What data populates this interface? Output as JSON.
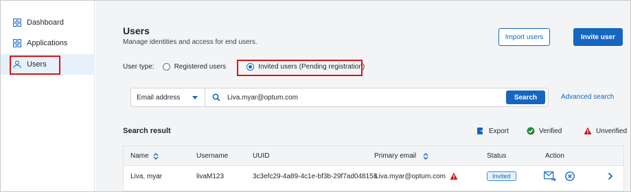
{
  "sidebar": {
    "items": [
      {
        "label": "Dashboard",
        "icon": "dashboard-icon"
      },
      {
        "label": "Applications",
        "icon": "applications-icon"
      },
      {
        "label": "Users",
        "icon": "user-icon",
        "active": true
      }
    ]
  },
  "header": {
    "title": "Users",
    "subtitle": "Manage identities and access for end users.",
    "import_label": "Import users",
    "invite_label": "Invite user"
  },
  "filters": {
    "user_type_label": "User type:",
    "options": [
      {
        "label": "Registered users",
        "checked": false
      },
      {
        "label": "Invited users (Pending registration)",
        "checked": true
      }
    ]
  },
  "search": {
    "field_label": "Email address",
    "value": "Liva.myar@optum.com",
    "button_label": "Search",
    "advanced_label": "Advanced search"
  },
  "results": {
    "title": "Search result",
    "export_label": "Export",
    "verified_label": "Verified",
    "unverified_label": "Unverified",
    "columns": [
      "Name",
      "Username",
      "UUID",
      "Primary email",
      "Status",
      "Action"
    ],
    "rows": [
      {
        "name": "Liva, myar",
        "username": "livaM123",
        "uuid": "3c3efc29-4a89-4c1e-bf3b-29f7ad048158",
        "email": "Liva.myar@optum.com",
        "status": "Invited"
      }
    ]
  },
  "colors": {
    "accent": "#1566c0",
    "highlight": "#d7141a",
    "verified": "#1e8a3c",
    "unverified": "#d7141a"
  }
}
